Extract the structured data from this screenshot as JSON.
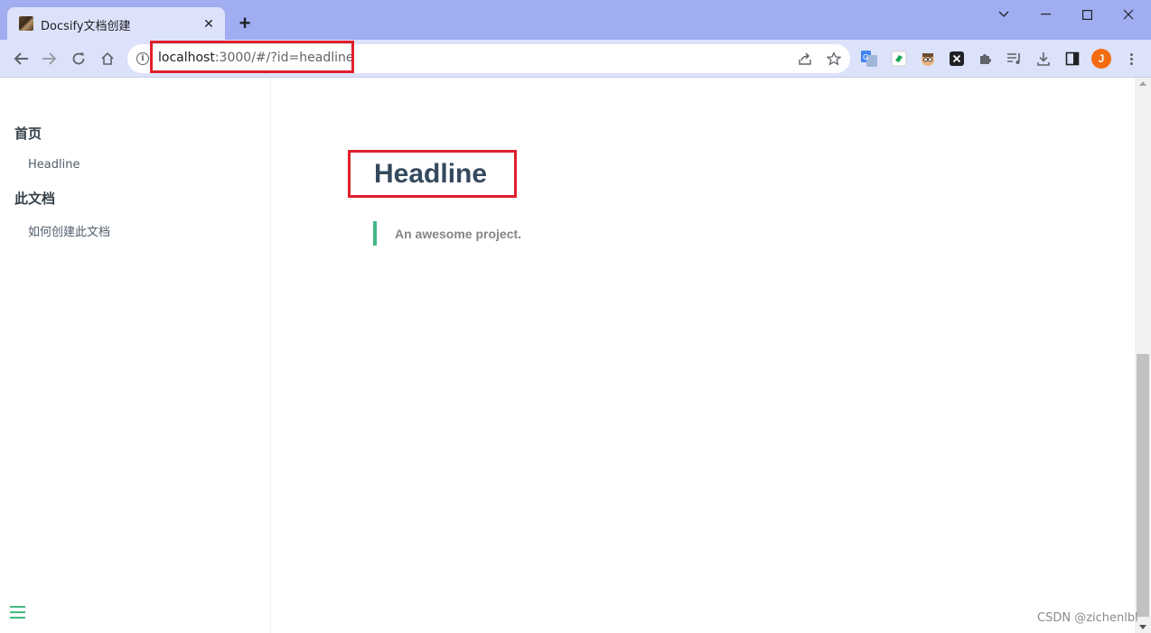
{
  "browser": {
    "tab_title": "Docsify文档创建",
    "tab_close": "✕",
    "new_tab": "+",
    "url_host": "localhost",
    "url_rest": ":3000/#/?id=headline",
    "profile_initial": "J",
    "window_controls": {
      "collapse": "⌄",
      "minimize": "—",
      "maximize": "☐",
      "close": "✕"
    }
  },
  "sidebar": {
    "sections": [
      {
        "heading": "首页",
        "links": [
          "Headline"
        ]
      },
      {
        "heading": "此文档",
        "links": [
          "如何创建此文档"
        ]
      }
    ]
  },
  "content": {
    "headline": "Headline",
    "quote": "An awesome project."
  },
  "watermark": "CSDN @zichenlbl",
  "colors": {
    "accent": "#42b983",
    "highlight_box": "#e0202a",
    "title_bar": "#a1adf1",
    "toolbar": "#dde2fb"
  }
}
